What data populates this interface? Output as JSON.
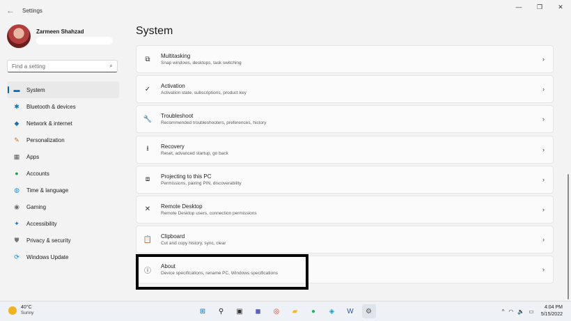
{
  "window": {
    "title": "Settings",
    "back_icon": "back-arrow-icon",
    "controls": {
      "minimize": "—",
      "maximize": "❐",
      "close": "✕"
    }
  },
  "profile": {
    "name": "Zarmeen Shahzad"
  },
  "search": {
    "placeholder": "Find a setting",
    "icon": "⌕"
  },
  "sidebar": {
    "items": [
      {
        "label": "System",
        "icon": "system-icon",
        "glyph": "▬",
        "color": "#0067c0",
        "active": true
      },
      {
        "label": "Bluetooth & devices",
        "icon": "bluetooth-icon",
        "glyph": "✱",
        "color": "#0078d4",
        "active": false
      },
      {
        "label": "Network & internet",
        "icon": "wifi-icon",
        "glyph": "◆",
        "color": "#1a6fb5",
        "active": false
      },
      {
        "label": "Personalization",
        "icon": "brush-icon",
        "glyph": "✎",
        "color": "#c1721a",
        "active": false
      },
      {
        "label": "Apps",
        "icon": "apps-icon",
        "glyph": "▦",
        "color": "#5a5a5a",
        "active": false
      },
      {
        "label": "Accounts",
        "icon": "person-icon",
        "glyph": "●",
        "color": "#2d9b58",
        "active": false
      },
      {
        "label": "Time & language",
        "icon": "globe-icon",
        "glyph": "◍",
        "color": "#1a8dd8",
        "active": false
      },
      {
        "label": "Gaming",
        "icon": "gamepad-icon",
        "glyph": "◉",
        "color": "#6b6b6b",
        "active": false
      },
      {
        "label": "Accessibility",
        "icon": "accessibility-icon",
        "glyph": "✦",
        "color": "#1c6fd1",
        "active": false
      },
      {
        "label": "Privacy & security",
        "icon": "shield-icon",
        "glyph": "⛊",
        "color": "#777777",
        "active": false
      },
      {
        "label": "Windows Update",
        "icon": "update-icon",
        "glyph": "⟳",
        "color": "#1a7fd4",
        "active": false
      }
    ]
  },
  "main": {
    "title": "System",
    "cards": [
      {
        "title": "Multitasking",
        "subtitle": "Snap windows, desktops, task switching",
        "icon": "multitasking-icon",
        "glyph": "⧉"
      },
      {
        "title": "Activation",
        "subtitle": "Activation state, subscriptions, product key",
        "icon": "checkmark-circle-icon",
        "glyph": "✓"
      },
      {
        "title": "Troubleshoot",
        "subtitle": "Recommended troubleshooters, preferences, history",
        "icon": "wrench-icon",
        "glyph": "🔧"
      },
      {
        "title": "Recovery",
        "subtitle": "Reset, advanced startup, go back",
        "icon": "recovery-icon",
        "glyph": "⭳"
      },
      {
        "title": "Projecting to this PC",
        "subtitle": "Permissions, pairing PIN, discoverability",
        "icon": "projection-icon",
        "glyph": "⧈"
      },
      {
        "title": "Remote Desktop",
        "subtitle": "Remote Desktop users, connection permissions",
        "icon": "remote-desktop-icon",
        "glyph": "✕"
      },
      {
        "title": "Clipboard",
        "subtitle": "Cut and copy history, sync, clear",
        "icon": "clipboard-icon",
        "glyph": "📋"
      },
      {
        "title": "About",
        "subtitle": "Device specifications, rename PC, Windows specifications",
        "icon": "info-icon",
        "glyph": "ⓘ"
      }
    ],
    "chevron": "›"
  },
  "taskbar": {
    "weather": {
      "temp": "40°C",
      "condition": "Sunny"
    },
    "apps": [
      {
        "name": "windows-start-icon",
        "glyph": "⊞",
        "color": "#0078d4"
      },
      {
        "name": "search-taskbar-icon",
        "glyph": "⚲",
        "color": "#1b1b1b"
      },
      {
        "name": "task-view-icon",
        "glyph": "▣",
        "color": "#333333"
      },
      {
        "name": "teams-chat-icon",
        "glyph": "◼",
        "color": "#5b5fc7"
      },
      {
        "name": "chrome-icon",
        "glyph": "◎",
        "color": "#db4437"
      },
      {
        "name": "file-explorer-icon",
        "glyph": "▰",
        "color": "#f2b72d"
      },
      {
        "name": "spotify-icon",
        "glyph": "●",
        "color": "#1db954"
      },
      {
        "name": "app-teal-icon",
        "glyph": "◈",
        "color": "#0aa4c2"
      },
      {
        "name": "word-icon",
        "glyph": "W",
        "color": "#2b579a"
      },
      {
        "name": "settings-taskbar-icon",
        "glyph": "⚙",
        "color": "#555555"
      }
    ],
    "tray": {
      "chevron": "^",
      "wifi": "◠",
      "volume": "🔈",
      "battery": "▭"
    },
    "clock": {
      "time": "4:04 PM",
      "date": "5/15/2022"
    }
  }
}
